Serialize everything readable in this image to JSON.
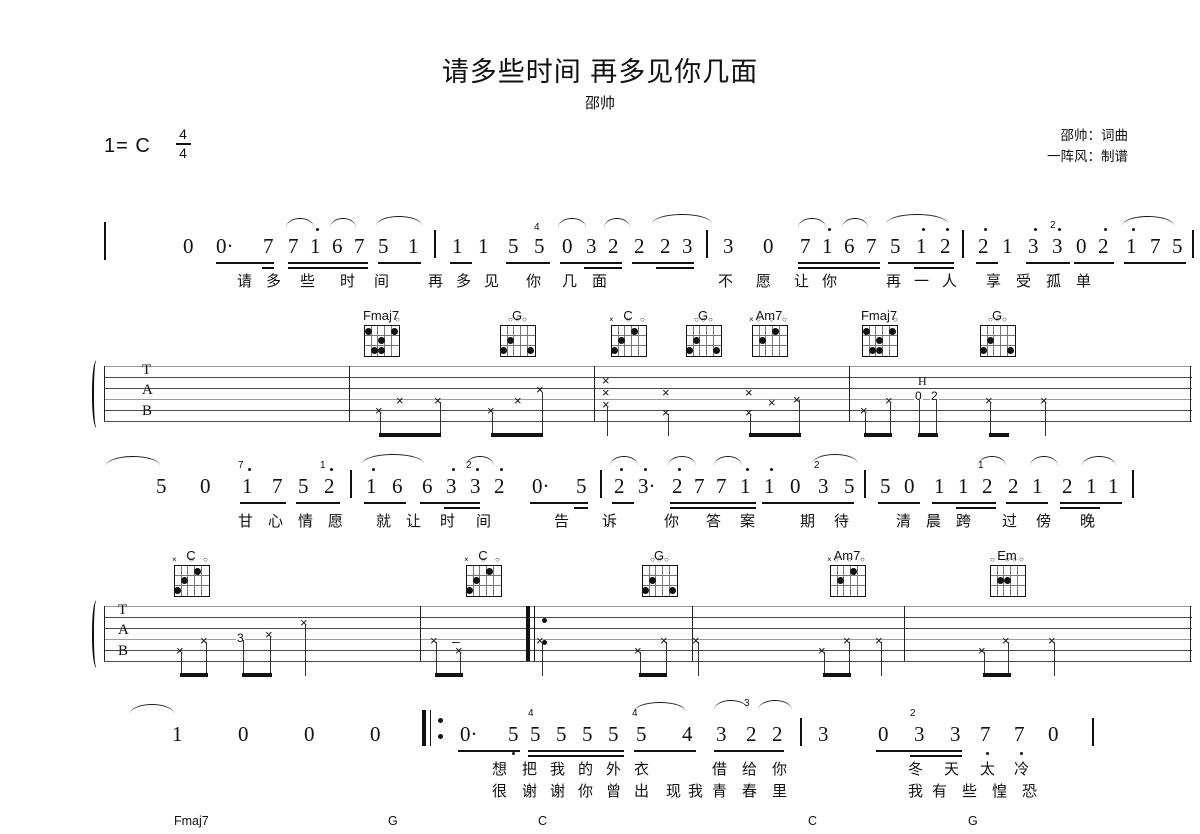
{
  "header": {
    "title": "请多些时间 再多见你几面",
    "artist": "邵帅",
    "credit_words_music": "邵帅：词曲",
    "credit_transcriber": "一阵风：制谱",
    "key_label": "1= C",
    "time_numerator": "4",
    "time_denominator": "4"
  },
  "system1": {
    "jianpu": "0  0· 7  7 1 6 7 5 1 | 1 1 5 5 0 3 2 2  2 3 | 3  0  7 1 6 7 5 1 2 | 2 1 3 3 0 2 1 7 5",
    "notes": [
      "0",
      "0·",
      "7",
      "7",
      "1",
      "6",
      "7",
      "5",
      "1",
      "1",
      "1",
      "5",
      "5",
      "0",
      "3",
      "2",
      "2",
      "2",
      "3",
      "3",
      "0",
      "7",
      "1",
      "6",
      "7",
      "5",
      "1",
      "2",
      "2",
      "1",
      "3",
      "3",
      "0",
      "2",
      "1",
      "7",
      "5"
    ],
    "lyrics": [
      "请",
      "多",
      "些",
      "时",
      "间",
      "再",
      "多",
      "见",
      "你",
      "几",
      "面",
      "不",
      "愿",
      "让",
      "你",
      "再",
      "一",
      "人",
      "享",
      "受",
      "孤",
      "单"
    ],
    "chords": [
      "Fmaj7",
      "G",
      "C",
      "G",
      "Am7",
      "Fmaj7",
      "G"
    ],
    "tab_hammer": "H",
    "tab_fret_numbers": [
      "0",
      "2"
    ]
  },
  "system2": {
    "notes": [
      "5",
      "0",
      "1",
      "7",
      "5",
      "2",
      "1",
      "6",
      "6",
      "3",
      "3",
      "2",
      "0·",
      "5",
      "2",
      "3·",
      "2",
      "7",
      "7",
      "1",
      "1",
      "0",
      "3",
      "5",
      "5",
      "0",
      "1",
      "1",
      "2",
      "2",
      "1",
      "2",
      "1",
      "1"
    ],
    "lyrics": [
      "甘",
      "心",
      "情",
      "愿",
      "就",
      "让",
      "时",
      "间",
      "告",
      "诉",
      "你",
      "答",
      "案",
      "期",
      "待",
      "清",
      "晨",
      "跨",
      "过",
      "傍",
      "晚"
    ],
    "chords": [
      "C",
      "C",
      "G",
      "Am7",
      "Em"
    ],
    "tab_fret_numbers": [
      "3"
    ]
  },
  "system3": {
    "notes": [
      "1",
      "0",
      "0",
      "0",
      "0·",
      "5",
      "5",
      "5",
      "5",
      "5",
      "5",
      "4",
      "3",
      "2",
      "2",
      "3",
      "0",
      "3",
      "3",
      "7",
      "7",
      "0"
    ],
    "lyrics_line1": [
      "想",
      "把",
      "我",
      "的",
      "外",
      "衣",
      "借",
      "给",
      "你",
      "冬",
      "天",
      "太",
      "冷"
    ],
    "lyrics_line2": [
      "很",
      "谢",
      "谢",
      "你",
      "曾",
      "出",
      "现",
      "我",
      "青",
      "春",
      "里",
      "我",
      "有",
      "些",
      "惶",
      "恐"
    ],
    "repeat_open": "‖:",
    "tuplet_3": "3",
    "tuplet_2": "2",
    "tuplet_4": "4"
  },
  "bottom_chords": [
    "Fmaj7",
    "G",
    "C",
    "C",
    "G"
  ],
  "colors": {
    "ink": "#111111",
    "staff_line": "#4a4a4a",
    "staff_line_light": "#9a9a9a",
    "background": "#ffffff"
  }
}
